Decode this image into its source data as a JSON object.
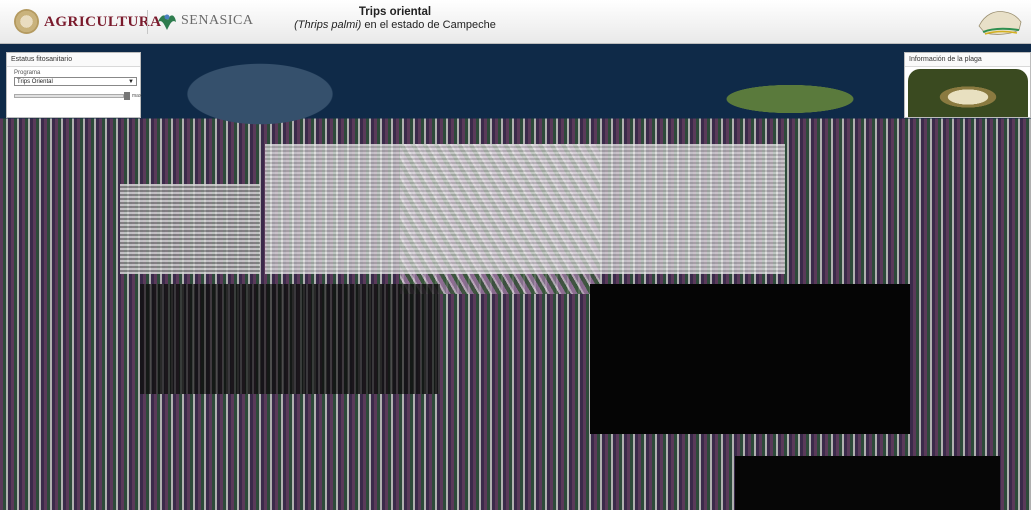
{
  "header": {
    "agency_primary": "AGRICULTURA",
    "agency_secondary": "SENASICA",
    "title_line1": "Trips oriental",
    "title_line2_species": "(Thrips palmi)",
    "title_line2_rest": " en el estado de Campeche"
  },
  "left_panel": {
    "title": "Estatus fitosanitario",
    "program_label": "Programa",
    "program_selected": "Trips Oriental",
    "opacity_max_label": "max"
  },
  "right_panel": {
    "title": "Información de la plaga"
  },
  "colors": {
    "brand_red": "#7a1a2c",
    "panel_bg": "#ffffff",
    "map_bg": "#0b1b2e"
  }
}
